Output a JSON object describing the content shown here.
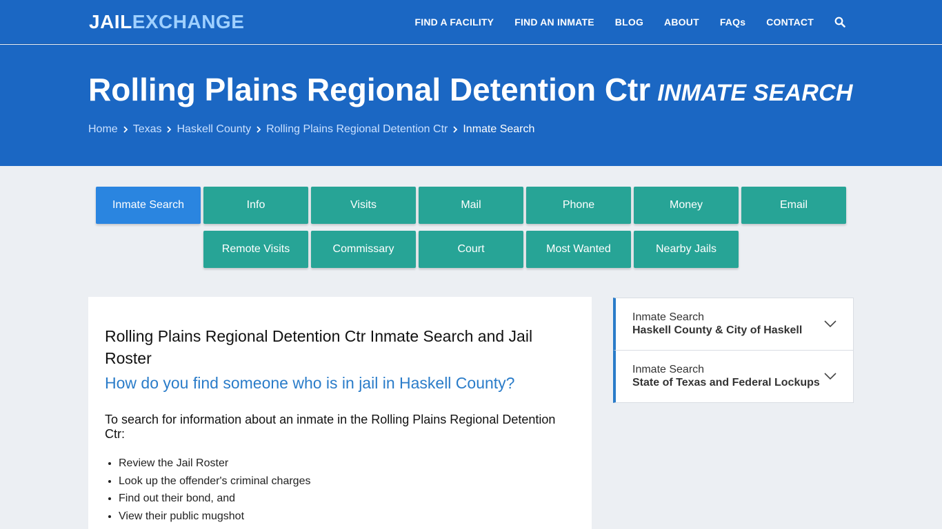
{
  "header": {
    "logo": {
      "part1": "JAIL",
      "part2": "EXCHANGE"
    },
    "nav": [
      "FIND A FACILITY",
      "FIND AN INMATE",
      "BLOG",
      "ABOUT",
      "FAQs",
      "CONTACT"
    ],
    "search_icon": "search-icon"
  },
  "hero": {
    "title": "Rolling Plains Regional Detention Ctr",
    "subtitle": "INMATE SEARCH",
    "breadcrumbs": [
      "Home",
      "Texas",
      "Haskell County",
      "Rolling Plains Regional Detention Ctr",
      "Inmate Search"
    ]
  },
  "tabs": {
    "row1": [
      "Inmate Search",
      "Info",
      "Visits",
      "Mail",
      "Phone",
      "Money",
      "Email"
    ],
    "row2": [
      "Remote Visits",
      "Commissary",
      "Court",
      "Most Wanted",
      "Nearby Jails"
    ]
  },
  "main": {
    "heading": "Rolling Plains Regional Detention Ctr Inmate Search and Jail Roster",
    "question": "How do you find someone who is in jail in Haskell County?",
    "intro": "To search for information about an inmate in the Rolling Plains Regional Detention Ctr:",
    "bullets": [
      "Review the Jail Roster",
      "Look up the offender's criminal charges",
      "Find out their bond, and",
      "View their public mugshot"
    ]
  },
  "sidebar": {
    "items": [
      {
        "line1": "Inmate Search",
        "line2": "Haskell County & City of Haskell"
      },
      {
        "line1": "Inmate Search",
        "line2": "State of Texas and Federal Lockups"
      }
    ]
  },
  "colors": {
    "brand_blue": "#1b67c3",
    "teal_button": "#27a496",
    "active_button": "#2a85e0",
    "link_blue": "#2a7cc9",
    "logo_accent": "#9fd0ff"
  }
}
